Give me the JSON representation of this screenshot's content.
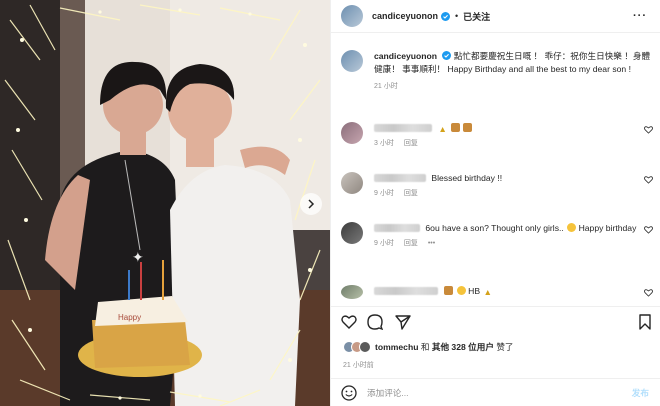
{
  "post": {
    "username": "candiceyuonon",
    "follow_status": "已关注",
    "separator": "•",
    "more_icon": "more-horizontal-icon",
    "caption_text": "點忙都要慶祝生日嘅 ！ 乖仔：祝你生日快樂 ！身體健康！ 事事順利！ Happy Birthday and all the best to my dear son !",
    "caption_time": "21 小时",
    "colors": {
      "accent": "#0095f6",
      "verified": "#1d9bf0",
      "link_disabled": "#b2dffc"
    }
  },
  "comments": [
    {
      "text": "",
      "time": "3 小时",
      "reply": "回复",
      "emojis": [
        "party-popper",
        "cake",
        "cake"
      ]
    },
    {
      "text": "Blessed birthday !!",
      "time": "9 小时",
      "reply": "回复"
    },
    {
      "text": "6ou have a son? Thought only girls..",
      "text2": "Happy birthday",
      "time": "9 小时",
      "reply": "回复",
      "more": "•••"
    },
    {
      "text": "",
      "text2": "HB",
      "emojis": [
        "cake",
        "heart-eyes",
        "party-popper"
      ]
    }
  ],
  "actions": [
    "like-icon",
    "comment-icon",
    "share-icon",
    "save-icon"
  ],
  "likes": {
    "user": "tommechu",
    "joiner": "和",
    "others": "其他 328 位用户",
    "suffix": "赞了"
  },
  "post_date": "21 小时前",
  "add_comment": {
    "placeholder": "添加评论...",
    "post_label": "发布"
  }
}
